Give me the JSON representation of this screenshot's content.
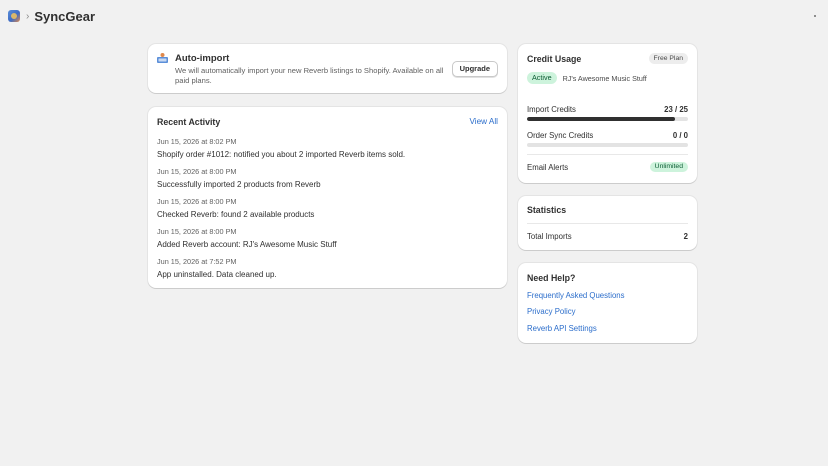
{
  "header": {
    "app_name": "SyncGear",
    "separator": "›",
    "app_icon": "syncgear-logo-icon"
  },
  "autoimport": {
    "title": "Auto-import",
    "description": "We will automatically import your new Reverb listings to Shopify. Available on all paid plans.",
    "button_label": "Upgrade",
    "icon": "reverb-import-icon"
  },
  "activity": {
    "title": "Recent Activity",
    "view_all_label": "View All",
    "items": [
      {
        "date": "Jun 15, 2026 at 8:02 PM",
        "text": "Shopify order #1012: notified you about 2 imported Reverb items sold."
      },
      {
        "date": "Jun 15, 2026 at 8:00 PM",
        "text": "Successfully imported 2 products from Reverb"
      },
      {
        "date": "Jun 15, 2026 at 8:00 PM",
        "text": "Checked Reverb: found 2 available products"
      },
      {
        "date": "Jun 15, 2026 at 8:00 PM",
        "text": "Added Reverb account: RJ's Awesome Music Stuff"
      },
      {
        "date": "Jun 15, 2026 at 7:52 PM",
        "text": "App uninstalled. Data cleaned up."
      }
    ]
  },
  "credits": {
    "title": "Credit Usage",
    "plan_badge": "Free Plan",
    "status": "Active",
    "store_name": "RJ's Awesome Music Stuff",
    "import_credits": {
      "label": "Import Credits",
      "value": "23 / 25",
      "used": 23,
      "total": 25
    },
    "order_sync_credits": {
      "label": "Order Sync Credits",
      "value": "0 / 0",
      "used": 0,
      "total": 0
    },
    "email_alerts": {
      "label": "Email Alerts",
      "badge": "Unlimited"
    }
  },
  "statistics": {
    "title": "Statistics",
    "total_imports_label": "Total Imports",
    "total_imports_value": "2"
  },
  "help": {
    "title": "Need Help?",
    "links": [
      "Frequently Asked Questions",
      "Privacy Policy",
      "Reverb API Settings"
    ]
  },
  "colors": {
    "page_bg": "#f1f1f1",
    "link": "#2c6ecb",
    "success_bg": "#cdf3dc",
    "success_text": "#0b5c33",
    "bar_fill": "#303030"
  }
}
